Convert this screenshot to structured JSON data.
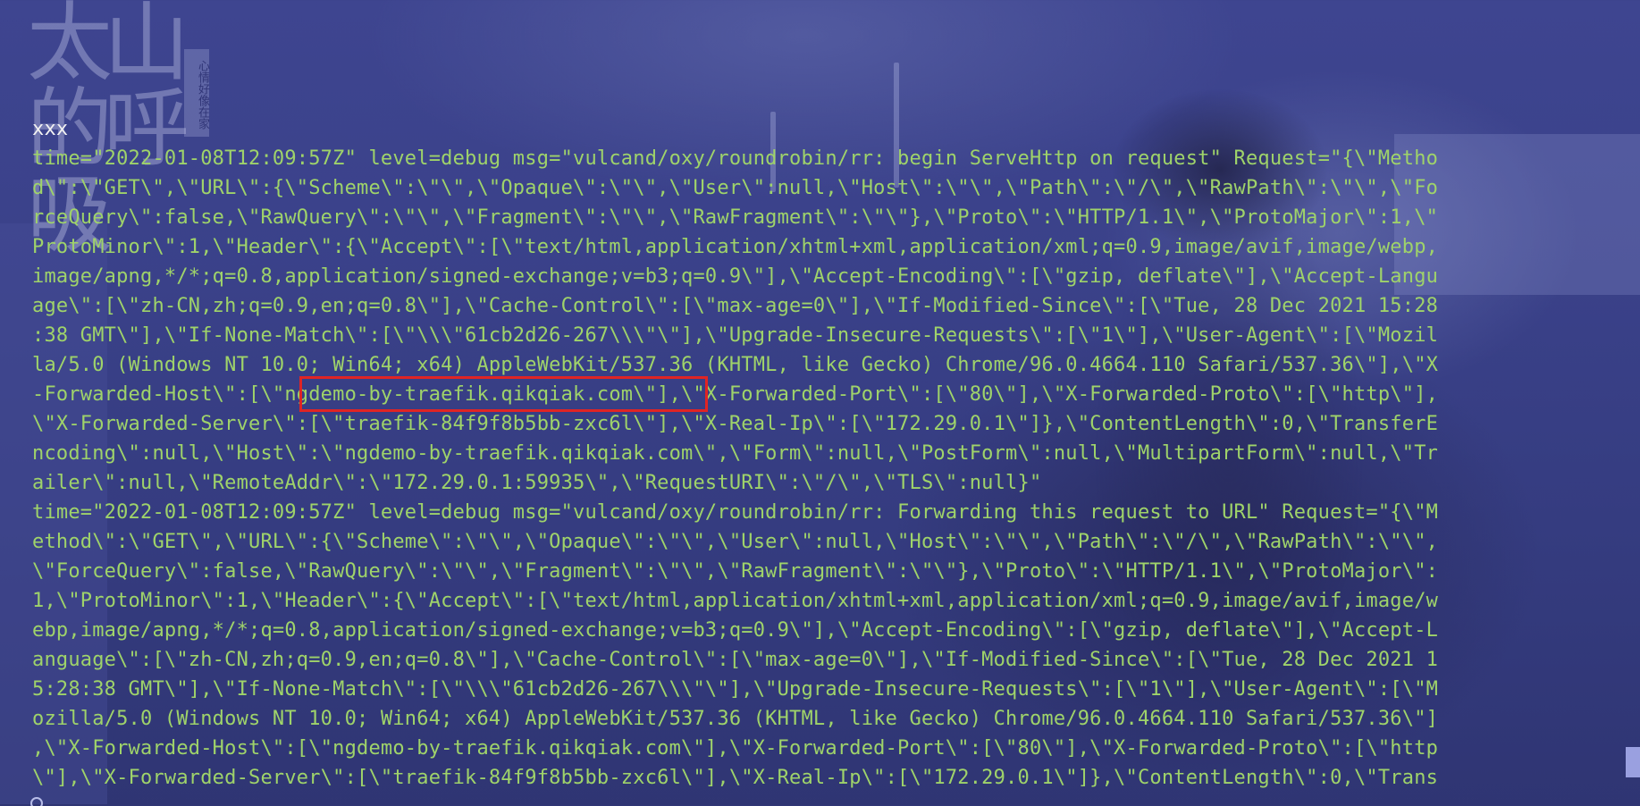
{
  "background": {
    "calligraphy_text": "太山的呼吸",
    "seal_text": "心情好像在家"
  },
  "terminal": {
    "first_line": "xxx",
    "lines": [
      "time=\"2022-01-08T12:09:57Z\" level=debug msg=\"vulcand/oxy/roundrobin/rr: begin ServeHttp on request\" Request=\"{\\\"Metho",
      "d\\\":\\\"GET\\\",\\\"URL\\\":{\\\"Scheme\\\":\\\"\\\",\\\"Opaque\\\":\\\"\\\",\\\"User\\\":null,\\\"Host\\\":\\\"\\\",\\\"Path\\\":\\\"/\\\",\\\"RawPath\\\":\\\"\\\",\\\"Fo",
      "rceQuery\\\":false,\\\"RawQuery\\\":\\\"\\\",\\\"Fragment\\\":\\\"\\\",\\\"RawFragment\\\":\\\"\\\"},\\\"Proto\\\":\\\"HTTP/1.1\\\",\\\"ProtoMajor\\\":1,\\\"",
      "ProtoMinor\\\":1,\\\"Header\\\":{\\\"Accept\\\":[\\\"text/html,application/xhtml+xml,application/xml;q=0.9,image/avif,image/webp,",
      "image/apng,*/*;q=0.8,application/signed-exchange;v=b3;q=0.9\\\"],\\\"Accept-Encoding\\\":[\\\"gzip, deflate\\\"],\\\"Accept-Langu",
      "age\\\":[\\\"zh-CN,zh;q=0.9,en;q=0.8\\\"],\\\"Cache-Control\\\":[\\\"max-age=0\\\"],\\\"If-Modified-Since\\\":[\\\"Tue, 28 Dec 2021 15:28",
      ":38 GMT\\\"],\\\"If-None-Match\\\":[\\\"\\\\\\\"61cb2d26-267\\\\\\\"\\\"],\\\"Upgrade-Insecure-Requests\\\":[\\\"1\\\"],\\\"User-Agent\\\":[\\\"Mozil",
      "la/5.0 (Windows NT 10.0; Win64; x64) AppleWebKit/537.36 (KHTML, like Gecko) Chrome/96.0.4664.110 Safari/537.36\\\"],\\\"X",
      "-Forwarded-Host\\\":[\\\"ngdemo-by-traefik.qikqiak.com\\\"],\\\"X-Forwarded-Port\\\":[\\\"80\\\"],\\\"X-Forwarded-Proto\\\":[\\\"http\\\"],",
      "\\\"X-Forwarded-Server\\\":[\\\"traefik-84f9f8b5bb-zxc6l\\\"],\\\"X-Real-Ip\\\":[\\\"172.29.0.1\\\"]},\\\"ContentLength\\\":0,\\\"TransferE",
      "ncoding\\\":null,\\\"Host\\\":\\\"ngdemo-by-traefik.qikqiak.com\\\",\\\"Form\\\":null,\\\"PostForm\\\":null,\\\"MultipartForm\\\":null,\\\"Tr",
      "ailer\\\":null,\\\"RemoteAddr\\\":\\\"172.29.0.1:59935\\\",\\\"RequestURI\\\":\\\"/\\\",\\\"TLS\\\":null}\"",
      "time=\"2022-01-08T12:09:57Z\" level=debug msg=\"vulcand/oxy/roundrobin/rr: Forwarding this request to URL\" Request=\"{\\\"M",
      "ethod\\\":\\\"GET\\\",\\\"URL\\\":{\\\"Scheme\\\":\\\"\\\",\\\"Opaque\\\":\\\"\\\",\\\"User\\\":null,\\\"Host\\\":\\\"\\\",\\\"Path\\\":\\\"/\\\",\\\"RawPath\\\":\\\"\\\",",
      "\\\"ForceQuery\\\":false,\\\"RawQuery\\\":\\\"\\\",\\\"Fragment\\\":\\\"\\\",\\\"RawFragment\\\":\\\"\\\"},\\\"Proto\\\":\\\"HTTP/1.1\\\",\\\"ProtoMajor\\\":",
      "1,\\\"ProtoMinor\\\":1,\\\"Header\\\":{\\\"Accept\\\":[\\\"text/html,application/xhtml+xml,application/xml;q=0.9,image/avif,image/w",
      "ebp,image/apng,*/*;q=0.8,application/signed-exchange;v=b3;q=0.9\\\"],\\\"Accept-Encoding\\\":[\\\"gzip, deflate\\\"],\\\"Accept-L",
      "anguage\\\":[\\\"zh-CN,zh;q=0.9,en;q=0.8\\\"],\\\"Cache-Control\\\":[\\\"max-age=0\\\"],\\\"If-Modified-Since\\\":[\\\"Tue, 28 Dec 2021 1",
      "5:28:38 GMT\\\"],\\\"If-None-Match\\\":[\\\"\\\\\\\"61cb2d26-267\\\\\\\"\\\"],\\\"Upgrade-Insecure-Requests\\\":[\\\"1\\\"],\\\"User-Agent\\\":[\\\"M",
      "ozilla/5.0 (Windows NT 10.0; Win64; x64) AppleWebKit/537.36 (KHTML, like Gecko) Chrome/96.0.4664.110 Safari/537.36\\\"]",
      ",\\\"X-Forwarded-Host\\\":[\\\"ngdemo-by-traefik.qikqiak.com\\\"],\\\"X-Forwarded-Port\\\":[\\\"80\\\"],\\\"X-Forwarded-Proto\\\":[\\\"http",
      "\\\"],\\\"X-Forwarded-Server\\\":[\\\"traefik-84f9f8b5bb-zxc6l\\\"],\\\"X-Real-Ip\\\":[\\\"172.29.0.1\\\"]},\\\"ContentLength\\\":0,\\\"Trans"
    ]
  },
  "annotation": {
    "highlighted_text": "\"ngdemo-by-traefik.qikqiak.com",
    "color": "#e02424"
  },
  "colors": {
    "log_text": "#9fd36a",
    "first_line_text": "#f2f2f2",
    "background": "#3a4189"
  }
}
